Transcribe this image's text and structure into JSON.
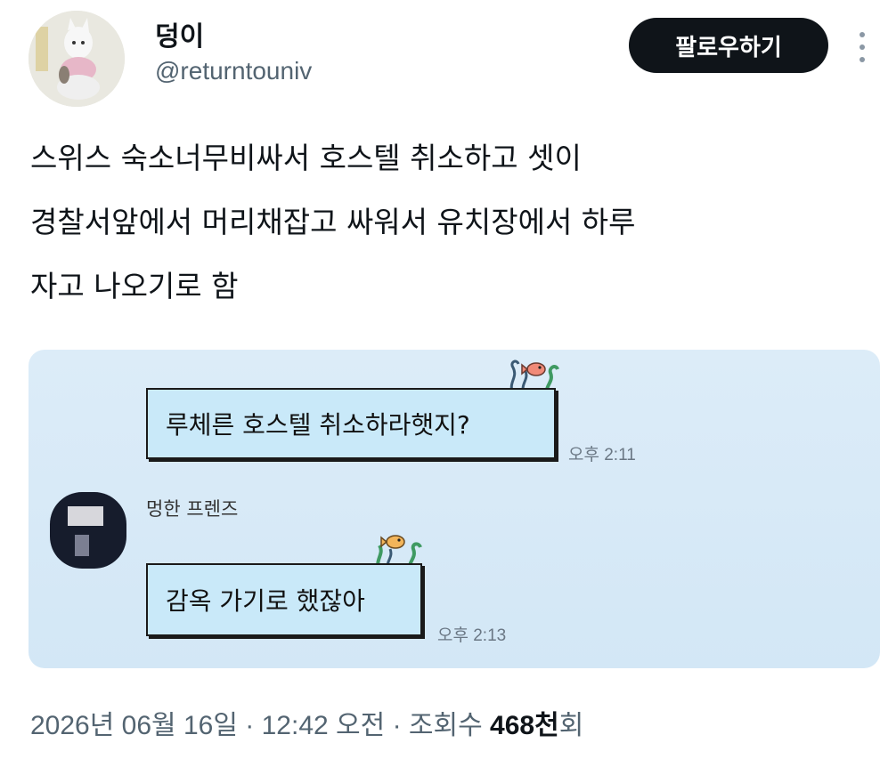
{
  "author": {
    "name": "덩이",
    "handle": "@returntouniv",
    "follow_label": "팔로우하기"
  },
  "tweet": {
    "lines": [
      "스위스 숙소너무비싸서 호스텔 취소하고 셋이",
      "경찰서앞에서 머리채잡고 싸워서 유치장에서 하루",
      "자고 나오기로 함"
    ]
  },
  "chat": {
    "messages": [
      {
        "text": "루체른 호스텔 취소하라햇지?",
        "time": "오후 2:11"
      },
      {
        "sender": "멍한 프렌즈",
        "text": "감옥 가기로 했잖아",
        "time": "오후 2:13"
      }
    ]
  },
  "meta": {
    "date": "2026년 06월 16일",
    "sep1": " · ",
    "time": "12:42 오전",
    "sep2": " · ",
    "views_label": "조회수 ",
    "views_count": "468천",
    "views_suffix": "회"
  },
  "icons": {
    "more": "more-vertical-icon",
    "deco": "seaweed-fish-icon"
  }
}
